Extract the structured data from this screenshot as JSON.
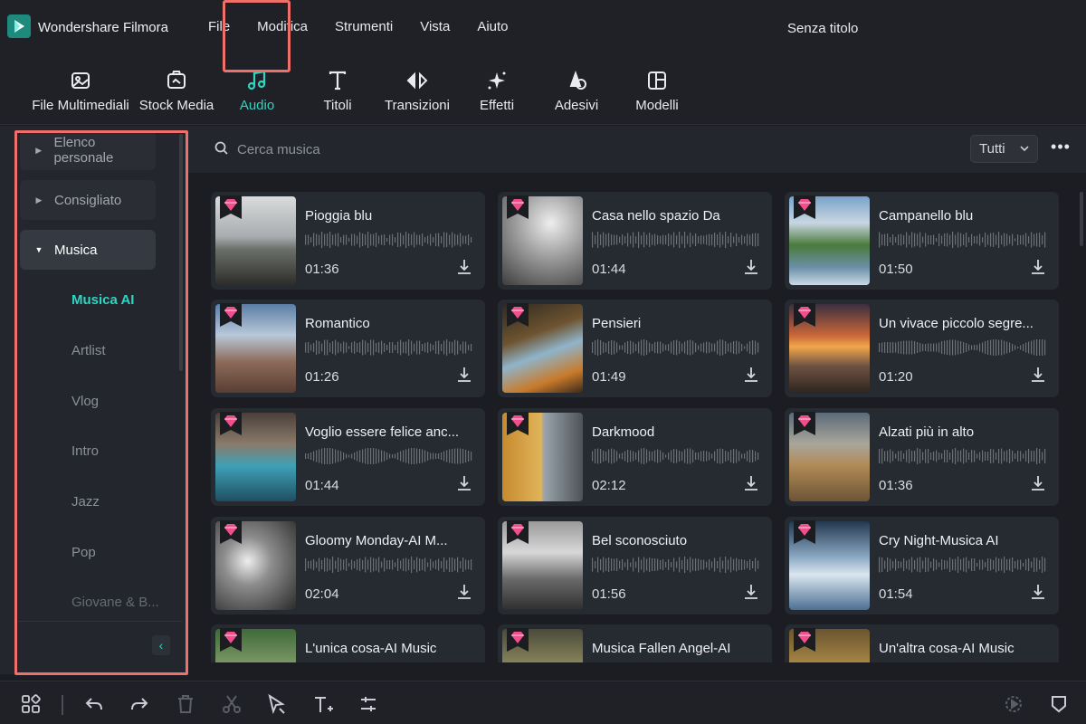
{
  "app": {
    "name": "Wondershare Filmora",
    "document_title": "Senza titolo"
  },
  "menu": [
    "File",
    "Modifica",
    "Strumenti",
    "Vista",
    "Aiuto"
  ],
  "toolbar": {
    "items": [
      {
        "label": "File Multimediali",
        "icon": "media-icon"
      },
      {
        "label": "Stock Media",
        "icon": "stock-media-icon"
      },
      {
        "label": "Audio",
        "icon": "music-note-icon",
        "active": true
      },
      {
        "label": "Titoli",
        "icon": "title-t-icon"
      },
      {
        "label": "Transizioni",
        "icon": "transition-icon"
      },
      {
        "label": "Effetti",
        "icon": "effects-sparkle-icon"
      },
      {
        "label": "Adesivi",
        "icon": "sticker-icon"
      },
      {
        "label": "Modelli",
        "icon": "templates-icon"
      }
    ]
  },
  "sidebar": {
    "categories": [
      {
        "label": "Elenco personale",
        "expanded": false
      },
      {
        "label": "Consigliato",
        "expanded": false
      },
      {
        "label": "Musica",
        "expanded": true
      }
    ],
    "subitems": [
      "Musica AI",
      "Artlist",
      "Vlog",
      "Intro",
      "Jazz",
      "Pop",
      "Giovane & B..."
    ],
    "selected_subitem": "Musica AI"
  },
  "search": {
    "placeholder": "Cerca musica",
    "filter": "Tutti"
  },
  "tracks": [
    {
      "title": "Pioggia blu",
      "duration": "01:36"
    },
    {
      "title": "Casa nello spazio Da",
      "duration": "01:44"
    },
    {
      "title": "Campanello blu",
      "duration": "01:50"
    },
    {
      "title": "Romantico",
      "duration": "01:26"
    },
    {
      "title": "Pensieri",
      "duration": "01:49"
    },
    {
      "title": "Un vivace piccolo segre...",
      "duration": "01:20"
    },
    {
      "title": "Voglio essere felice anc...",
      "duration": "01:44"
    },
    {
      "title": "Darkmood",
      "duration": "02:12"
    },
    {
      "title": "Alzati più in alto",
      "duration": "01:36"
    },
    {
      "title": "Gloomy Monday-AI M...",
      "duration": "02:04"
    },
    {
      "title": "Bel sconosciuto",
      "duration": "01:56"
    },
    {
      "title": "Cry Night-Musica AI",
      "duration": "01:54"
    },
    {
      "title": "L'unica cosa-AI Music",
      "duration": ""
    },
    {
      "title": "Musica Fallen Angel-AI",
      "duration": ""
    },
    {
      "title": "Un'altra cosa-AI Music",
      "duration": ""
    }
  ],
  "colors": {
    "accent": "#2fd5c1",
    "highlight": "#ef6f6a",
    "premium_badge": "#f04e8c"
  }
}
